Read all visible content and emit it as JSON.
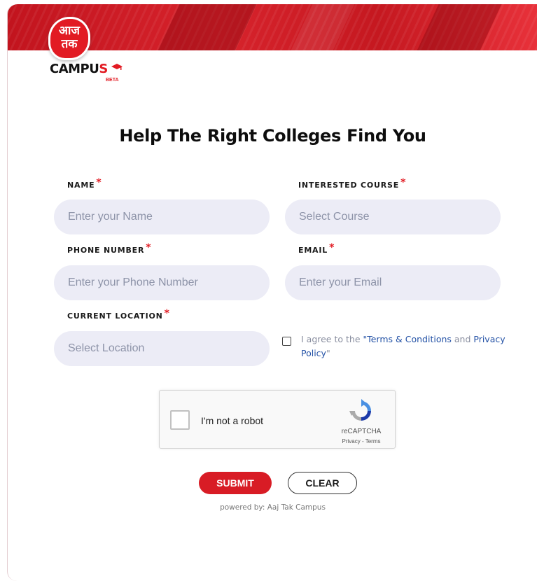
{
  "brand": {
    "badge_line1": "आज",
    "badge_line2": "तक",
    "name_black": "CAMPU",
    "name_red": "S",
    "beta": "BETA",
    "colors": {
      "primary": "#d81c25",
      "field_bg": "#ececf6",
      "link": "#2452a6"
    }
  },
  "form": {
    "title": "Help The Right Colleges Find You",
    "required_mark": "*",
    "name": {
      "label": "NAME",
      "placeholder": "Enter your Name"
    },
    "course": {
      "label": "INTERESTED COURSE",
      "placeholder": "Select Course"
    },
    "phone": {
      "label": "PHONE NUMBER",
      "placeholder": "Enter your Phone Number"
    },
    "email": {
      "label": "EMAIL",
      "placeholder": "Enter your Email"
    },
    "location": {
      "label": "CURRENT LOCATION",
      "placeholder": "Select Location"
    },
    "agree": {
      "prefix": "I agree to the ",
      "terms_link": "\"Terms & Conditions",
      "middle": " and ",
      "privacy_link": "Privacy Policy",
      "suffix": "\""
    }
  },
  "captcha": {
    "label": "I'm not a robot",
    "brand": "reCAPTCHA",
    "links": "Privacy - Terms"
  },
  "actions": {
    "submit": "SUBMIT",
    "clear": "CLEAR"
  },
  "footer": {
    "powered": "powered by: Aaj Tak Campus"
  }
}
